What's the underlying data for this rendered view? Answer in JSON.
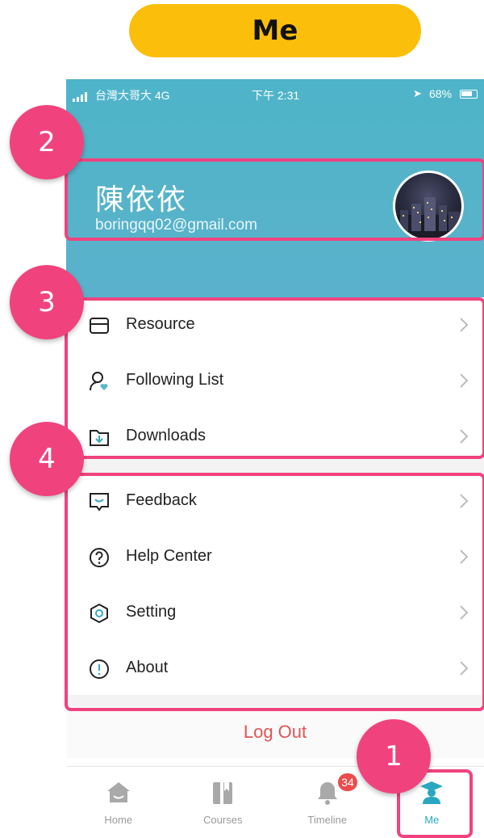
{
  "top_label": "Me",
  "status_bar": {
    "carrier": "台灣大哥大  4G",
    "time": "下午 2:31",
    "battery": "68%"
  },
  "profile": {
    "name": "陳依依",
    "email": "boringqq02@gmail.com"
  },
  "menu_group_1": [
    {
      "label": "Resource",
      "icon": "box-icon"
    },
    {
      "label": "Following List",
      "icon": "person-heart-icon"
    },
    {
      "label": "Downloads",
      "icon": "download-folder-icon"
    }
  ],
  "menu_group_2": [
    {
      "label": "Feedback",
      "icon": "feedback-icon"
    },
    {
      "label": "Help Center",
      "icon": "question-icon"
    },
    {
      "label": "Setting",
      "icon": "hexagon-gear-icon"
    },
    {
      "label": "About",
      "icon": "info-icon"
    }
  ],
  "logout_label": "Log Out",
  "tabs": [
    {
      "label": "Home",
      "icon": "home-icon"
    },
    {
      "label": "Courses",
      "icon": "courses-icon"
    },
    {
      "label": "Timeline",
      "icon": "bell-icon",
      "badge": "34"
    },
    {
      "label": "Me",
      "icon": "graduate-icon"
    }
  ],
  "annotations": [
    "1",
    "2",
    "3",
    "4"
  ],
  "colors": {
    "header_teal": "#52b3c9",
    "annotation_pink": "#f0437e",
    "top_pill_yellow": "#fbbf0b",
    "logout_red": "#e05555",
    "active_tab": "#2aa7c0"
  }
}
